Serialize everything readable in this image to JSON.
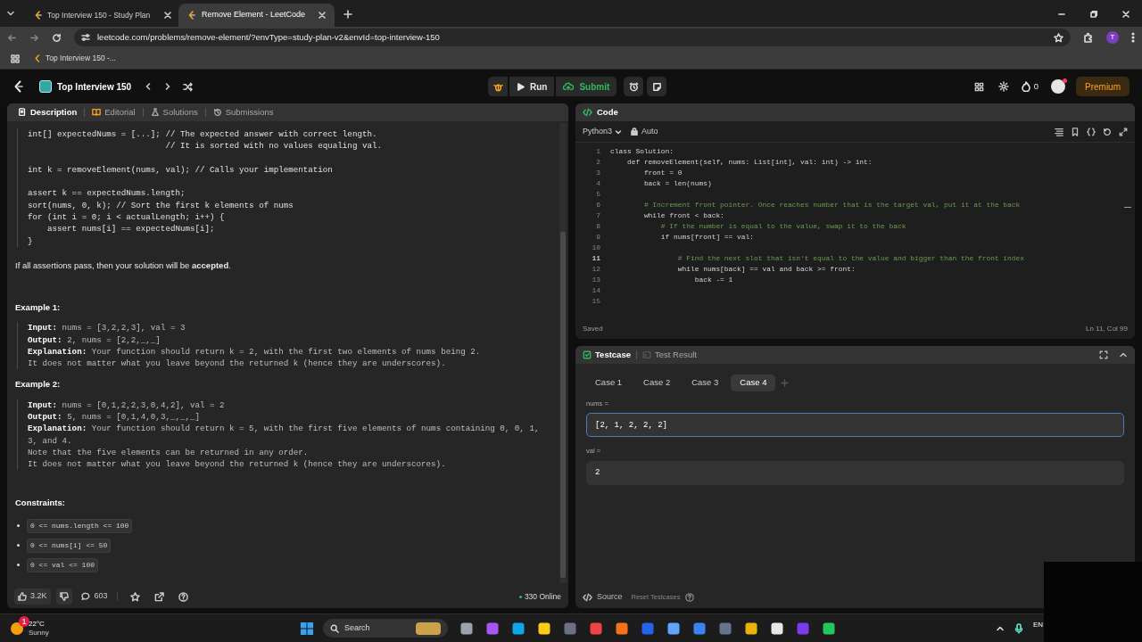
{
  "browser": {
    "tabs": [
      {
        "title": "Top Interview 150 - Study Plan",
        "selected": false
      },
      {
        "title": "Remove Element - LeetCode",
        "selected": true
      }
    ],
    "url": "leetcode.com/problems/remove-element/?envType=study-plan-v2&envId=top-interview-150",
    "profile_initial": "T",
    "bookmarks": [
      "Top Interview 150 -..."
    ]
  },
  "header": {
    "title": "Top Interview 150",
    "run": "Run",
    "submit": "Submit",
    "streak": "0",
    "premium": "Premium"
  },
  "left_panel": {
    "tabs": [
      {
        "label": "Description",
        "selected": true
      },
      {
        "label": "Editorial",
        "selected": false
      },
      {
        "label": "Solutions",
        "selected": false
      },
      {
        "label": "Submissions",
        "selected": false
      }
    ],
    "code_block": [
      {
        "kind": "code",
        "text": "int[] expectedNums = [...]; // The expected answer with correct length."
      },
      {
        "kind": "code",
        "text": "                            // It is sorted with no values equaling val."
      },
      {
        "kind": "blank"
      },
      {
        "kind": "code",
        "text": "int k = removeElement(nums, val); // Calls your implementation"
      },
      {
        "kind": "blank"
      },
      {
        "kind": "code",
        "text": "assert k == expectedNums.length;"
      },
      {
        "kind": "code",
        "text": "sort(nums, 0, k); // Sort the first k elements of nums"
      },
      {
        "kind": "code",
        "text": "for (int i = 0; i < actualLength; i++) {"
      },
      {
        "kind": "code",
        "text": "    assert nums[i] == expectedNums[i];"
      },
      {
        "kind": "code",
        "text": "}"
      }
    ],
    "note": "If all assertions pass, then your solution will be **accepted**.",
    "examples": [
      {
        "title": "Example 1:",
        "lines": [
          {
            "label": "Input:",
            "text": "nums = [3,2,2,3], val = 3"
          },
          {
            "label": "Output:",
            "text": "2, nums = [2,2,_,_]"
          },
          {
            "label": "Explanation:",
            "text": "Your function should return k = 2, with the first two elements of nums being 2."
          },
          {
            "text": "It does not matter what you leave beyond the returned k (hence they are underscores)."
          }
        ]
      },
      {
        "title": "Example 2:",
        "lines": [
          {
            "label": "Input:",
            "text": "nums = [0,1,2,2,3,0,4,2], val = 2"
          },
          {
            "label": "Output:",
            "text": "5, nums = [0,1,4,0,3,_,_,_]"
          },
          {
            "label": "Explanation:",
            "text": "Your function should return k = 5, with the first five elements of nums containing 0, 0, 1, 3, and 4."
          },
          {
            "text": "Note that the five elements can be returned in any order."
          },
          {
            "text": "It does not matter what you leave beyond the returned k (hence they are underscores)."
          }
        ]
      }
    ],
    "constraints_title": "Constraints:",
    "constraints": [
      "0 <= nums.length <= 100",
      "0 <= nums[i] <= 50",
      "0 <= val <= 100"
    ],
    "footer": {
      "likes": "3.2K",
      "comments": "603",
      "online": "330 Online"
    }
  },
  "editor": {
    "title": "Code",
    "language": "Python3",
    "mode": "Auto",
    "lines": [
      {
        "number": "1",
        "kind": "code",
        "text": "class Solution:",
        "active": false
      },
      {
        "number": "2",
        "kind": "code",
        "text": "    def removeElement(self, nums: List[int], val: int) -> int:",
        "active": false
      },
      {
        "number": "3",
        "kind": "code",
        "text": "        front = 0",
        "active": false
      },
      {
        "number": "4",
        "kind": "code",
        "text": "        back = len(nums)",
        "active": false
      },
      {
        "number": "5",
        "kind": "blank",
        "active": false
      },
      {
        "number": "6",
        "kind": "comment",
        "text": "        # Increment front pointer. Once reaches number that is the target val, put it at the back",
        "active": false
      },
      {
        "number": "7",
        "kind": "code",
        "text": "        while front < back:",
        "active": false
      },
      {
        "number": "8",
        "kind": "comment",
        "text": "            # If the number is equal to the value, swap it to the back",
        "active": false
      },
      {
        "number": "9",
        "kind": "code",
        "text": "            if nums[front] == val:",
        "active": false
      },
      {
        "number": "10",
        "kind": "blank",
        "active": false
      },
      {
        "number": "11",
        "kind": "comment",
        "text": "                # Find the next slot that isn't equal to the value and bigger than the front index",
        "active": true
      },
      {
        "number": "12",
        "kind": "code",
        "text": "                while nums[back] == val and back >= front:",
        "active": false
      },
      {
        "number": "13",
        "kind": "code",
        "text": "                    back -= 1",
        "active": false
      },
      {
        "number": "14",
        "kind": "blank",
        "active": false
      },
      {
        "number": "15",
        "kind": "blank",
        "active": false
      }
    ],
    "status": "Saved",
    "position": "Ln 11, Col 99"
  },
  "testcase": {
    "tabs": [
      {
        "label": "Testcase",
        "selected": true
      },
      {
        "label": "Test Result",
        "selected": false
      }
    ],
    "cases": [
      {
        "label": "Case 1",
        "selected": false
      },
      {
        "label": "Case 2",
        "selected": false
      },
      {
        "label": "Case 3",
        "selected": false
      },
      {
        "label": "Case 4",
        "selected": true
      }
    ],
    "params": [
      {
        "name": "nums =",
        "value": "[2, 1, 2, 2, 2]",
        "focused": true
      },
      {
        "name": "val =",
        "value": "2",
        "focused": false
      }
    ],
    "source": "Source",
    "reset": "Reset Testcases"
  },
  "taskbar": {
    "temperature": "22°C",
    "weather": "Sunny",
    "badge": "1",
    "search": "Search",
    "language": "EN"
  }
}
